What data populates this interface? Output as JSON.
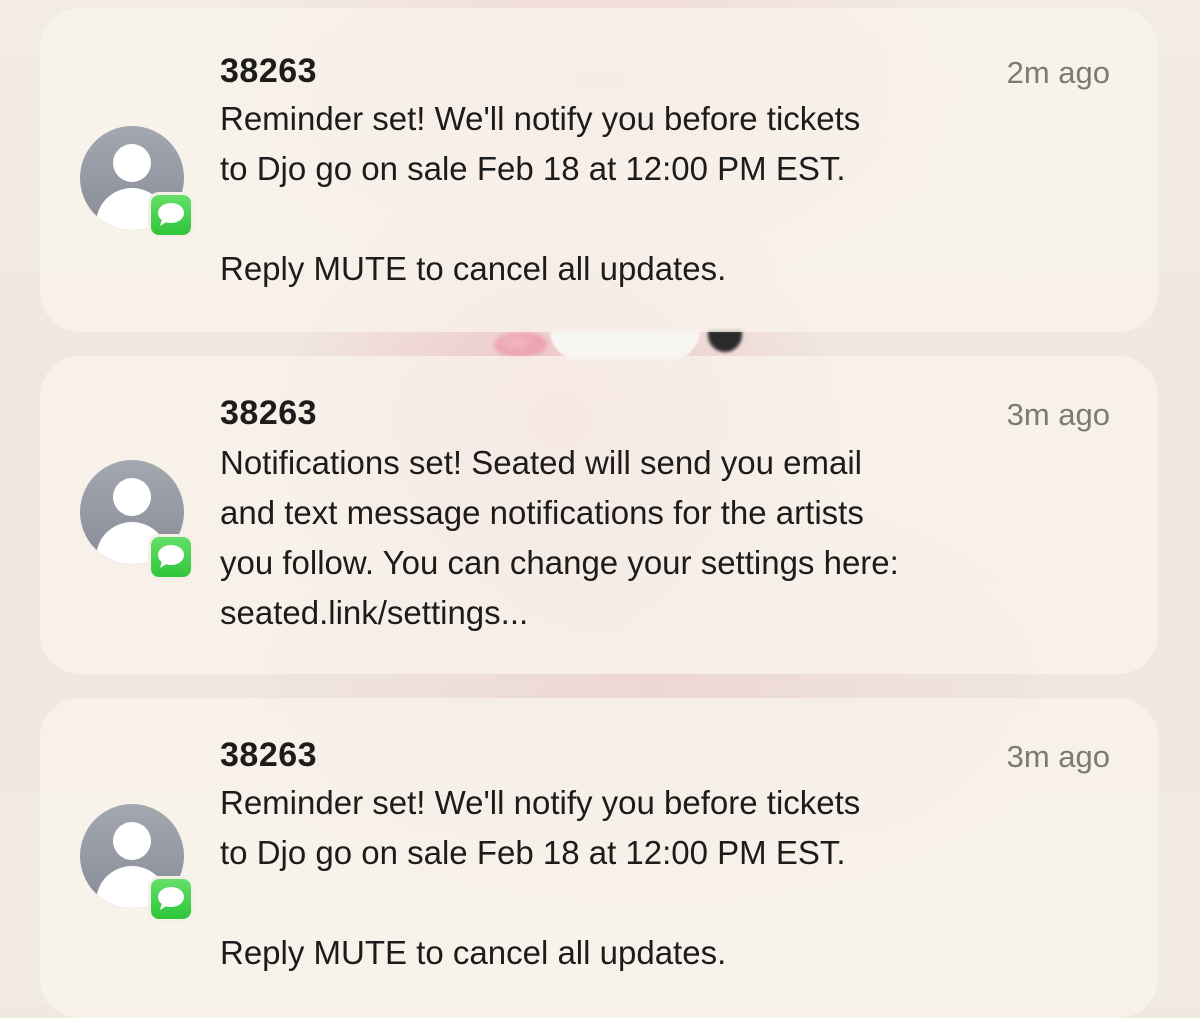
{
  "notifications": [
    {
      "sender": "38263",
      "time": "2m ago",
      "lines": [
        "Reminder set! We'll notify you before tickets",
        "to Djo go on sale Feb 18 at 12:00 PM EST."
      ],
      "footer": "Reply MUTE to cancel all updates."
    },
    {
      "sender": "38263",
      "time": "3m ago",
      "lines": [
        "Notifications set! Seated will send you email",
        "and text message notifications for the artists",
        "you follow. You can change your settings here:",
        "seated.link/settings..."
      ]
    },
    {
      "sender": "38263",
      "time": "3m ago",
      "lines": [
        "Reminder set! We'll notify you before tickets",
        "to Djo go on sale Feb 18 at 12:00 PM EST."
      ],
      "footer": "Reply MUTE to cancel all updates."
    }
  ],
  "icons": {
    "avatar": "person-placeholder-icon",
    "app_badge": "messages-app-icon"
  },
  "colors": {
    "messages_green": "#34c759",
    "avatar_gray": "#8e929b",
    "timestamp_gray": "#7d7a75"
  }
}
